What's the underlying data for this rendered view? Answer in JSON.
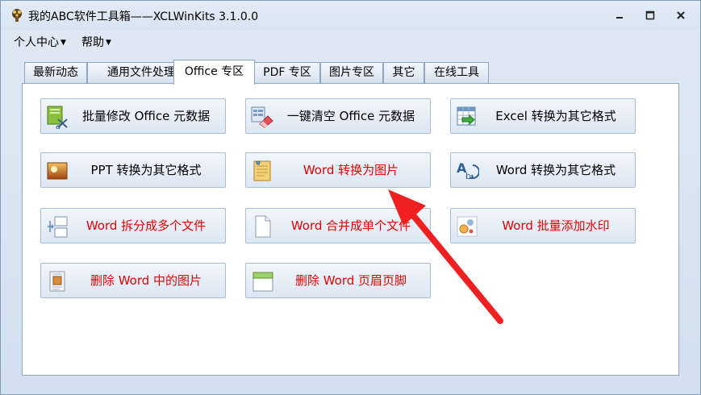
{
  "window": {
    "title": "我的ABC软件工具箱——XCLWinKits  3.1.0.0",
    "controls": [
      "minimize",
      "maximize",
      "close"
    ]
  },
  "menu": {
    "items": [
      {
        "label": "个人中心"
      },
      {
        "label": "帮助"
      }
    ]
  },
  "tabs": [
    {
      "label": "最新动态"
    },
    {
      "label": "通用文件处理"
    },
    {
      "label": "Office 专区",
      "active": true
    },
    {
      "label": "PDF 专区"
    },
    {
      "label": "图片专区"
    },
    {
      "label": "其它"
    },
    {
      "label": "在线工具"
    }
  ],
  "buttons": [
    {
      "label": "批量修改 Office 元数据",
      "icon": "edit-metadata-icon",
      "highlight": false
    },
    {
      "label": "一键清空 Office 元数据",
      "icon": "eraser-icon",
      "highlight": false
    },
    {
      "label": "Excel 转换为其它格式",
      "icon": "excel-convert-icon",
      "highlight": false
    },
    {
      "label": "PPT 转换为其它格式",
      "icon": "ppt-image-icon",
      "highlight": false
    },
    {
      "label": "Word 转换为图片",
      "icon": "notepad-icon",
      "highlight": true
    },
    {
      "label": "Word 转换为其它格式",
      "icon": "text-convert-icon",
      "highlight": false
    },
    {
      "label": "Word 拆分成多个文件",
      "icon": "split-file-icon",
      "highlight": true
    },
    {
      "label": "Word 合并成单个文件",
      "icon": "blank-document-icon",
      "highlight": true
    },
    {
      "label": "Word 批量添加水印",
      "icon": "watermark-icon",
      "highlight": true
    },
    {
      "label": "删除 Word 中的图片",
      "icon": "delete-image-icon",
      "highlight": true
    },
    {
      "label": "删除 Word 页眉页脚",
      "icon": "header-footer-icon",
      "highlight": true
    }
  ],
  "colors": {
    "highlight_text": "#e60000",
    "annotation_arrow": "#f02020"
  }
}
